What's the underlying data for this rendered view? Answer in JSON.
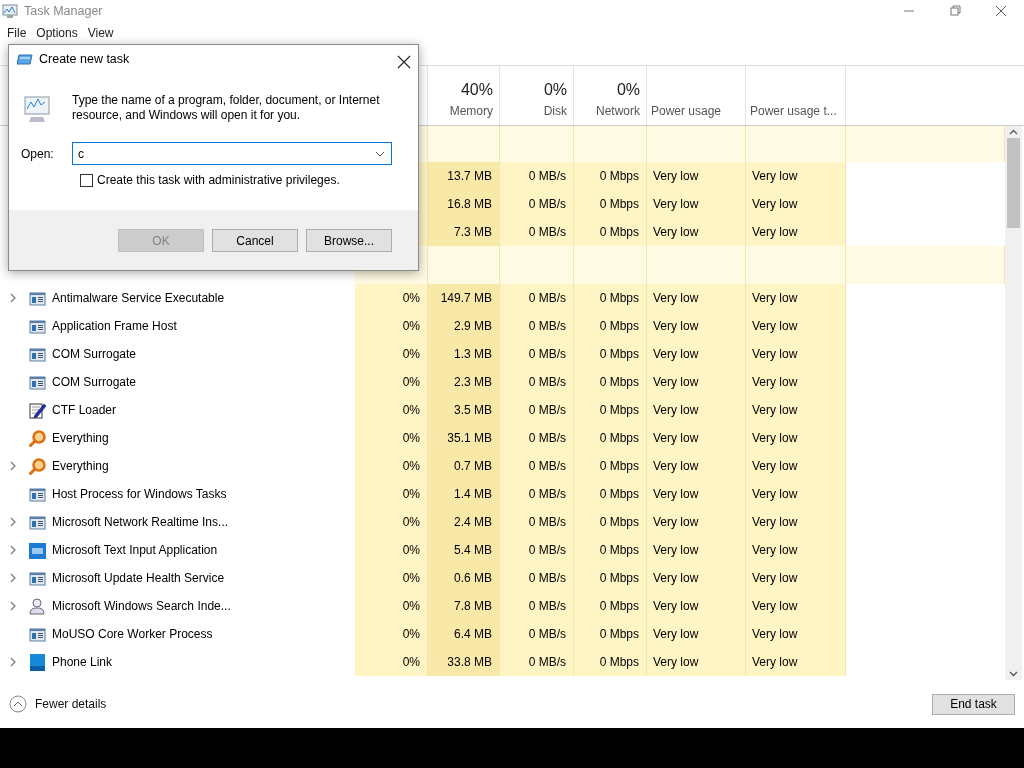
{
  "window": {
    "title": "Task Manager"
  },
  "menu": [
    "File",
    "Options",
    "View"
  ],
  "columns": [
    {
      "percent": "40%",
      "label": "Memory"
    },
    {
      "percent": "0%",
      "label": "Disk"
    },
    {
      "percent": "0%",
      "label": "Network"
    },
    {
      "label": "Power usage"
    },
    {
      "label": "Power usage t..."
    }
  ],
  "covered_rows": [
    {
      "memory": "13.7 MB",
      "disk": "0 MB/s",
      "network": "0 Mbps",
      "power": "Very low",
      "power_trend": "Very low"
    },
    {
      "memory": "16.8 MB",
      "disk": "0 MB/s",
      "network": "0 Mbps",
      "power": "Very low",
      "power_trend": "Very low"
    },
    {
      "memory": "7.3 MB",
      "disk": "0 MB/s",
      "network": "0 Mbps",
      "power": "Very low",
      "power_trend": "Very low"
    }
  ],
  "rows": [
    {
      "name": "Antimalware Service Executable",
      "kind": "service",
      "expandable": true,
      "cpu": "0%",
      "memory": "149.7 MB",
      "disk": "0 MB/s",
      "network": "0 Mbps",
      "power": "Very low",
      "power_trend": "Very low"
    },
    {
      "name": "Application Frame Host",
      "kind": "service",
      "expandable": false,
      "cpu": "0%",
      "memory": "2.9 MB",
      "disk": "0 MB/s",
      "network": "0 Mbps",
      "power": "Very low",
      "power_trend": "Very low"
    },
    {
      "name": "COM Surrogate",
      "kind": "service",
      "expandable": false,
      "cpu": "0%",
      "memory": "1.3 MB",
      "disk": "0 MB/s",
      "network": "0 Mbps",
      "power": "Very low",
      "power_trend": "Very low"
    },
    {
      "name": "COM Surrogate",
      "kind": "service",
      "expandable": false,
      "cpu": "0%",
      "memory": "2.3 MB",
      "disk": "0 MB/s",
      "network": "0 Mbps",
      "power": "Very low",
      "power_trend": "Very low"
    },
    {
      "name": "CTF Loader",
      "kind": "pen",
      "expandable": false,
      "cpu": "0%",
      "memory": "3.5 MB",
      "disk": "0 MB/s",
      "network": "0 Mbps",
      "power": "Very low",
      "power_trend": "Very low"
    },
    {
      "name": "Everything",
      "kind": "magnifier",
      "expandable": false,
      "cpu": "0%",
      "memory": "35.1 MB",
      "disk": "0 MB/s",
      "network": "0 Mbps",
      "power": "Very low",
      "power_trend": "Very low"
    },
    {
      "name": "Everything",
      "kind": "magnifier",
      "expandable": true,
      "cpu": "0%",
      "memory": "0.7 MB",
      "disk": "0 MB/s",
      "network": "0 Mbps",
      "power": "Very low",
      "power_trend": "Very low"
    },
    {
      "name": "Host Process for Windows Tasks",
      "kind": "service",
      "expandable": false,
      "cpu": "0%",
      "memory": "1.4 MB",
      "disk": "0 MB/s",
      "network": "0 Mbps",
      "power": "Very low",
      "power_trend": "Very low"
    },
    {
      "name": "Microsoft Network Realtime Ins...",
      "kind": "service",
      "expandable": true,
      "cpu": "0%",
      "memory": "2.4 MB",
      "disk": "0 MB/s",
      "network": "0 Mbps",
      "power": "Very low",
      "power_trend": "Very low"
    },
    {
      "name": "Microsoft Text Input Application",
      "kind": "keyboard",
      "expandable": true,
      "cpu": "0%",
      "memory": "5.4 MB",
      "disk": "0 MB/s",
      "network": "0 Mbps",
      "power": "Very low",
      "power_trend": "Very low"
    },
    {
      "name": "Microsoft Update Health Service",
      "kind": "service",
      "expandable": true,
      "cpu": "0%",
      "memory": "0.6 MB",
      "disk": "0 MB/s",
      "network": "0 Mbps",
      "power": "Very low",
      "power_trend": "Very low"
    },
    {
      "name": "Microsoft Windows Search Inde...",
      "kind": "user",
      "expandable": true,
      "cpu": "0%",
      "memory": "7.8 MB",
      "disk": "0 MB/s",
      "network": "0 Mbps",
      "power": "Very low",
      "power_trend": "Very low"
    },
    {
      "name": "MoUSO Core Worker Process",
      "kind": "service",
      "expandable": false,
      "cpu": "0%",
      "memory": "6.4 MB",
      "disk": "0 MB/s",
      "network": "0 Mbps",
      "power": "Very low",
      "power_trend": "Very low"
    },
    {
      "name": "Phone Link",
      "kind": "tile",
      "expandable": true,
      "cpu": "0%",
      "memory": "33.8 MB",
      "disk": "0 MB/s",
      "network": "0 Mbps",
      "power": "Very low",
      "power_trend": "Very low"
    }
  ],
  "footer": {
    "details_link": "Fewer details",
    "end_button": "End task"
  },
  "dialog": {
    "title": "Create new task",
    "message": "Type the name of a program, folder, document, or Internet resource, and Windows will open it for you.",
    "open_label": "Open:",
    "value": "c",
    "admin": {
      "label": "Create this task with administrative privileges.",
      "checked": false
    },
    "buttons": [
      {
        "label": "OK",
        "disabled": true
      },
      {
        "label": "Cancel",
        "disabled": false
      },
      {
        "label": "Browse...",
        "disabled": false
      }
    ]
  }
}
